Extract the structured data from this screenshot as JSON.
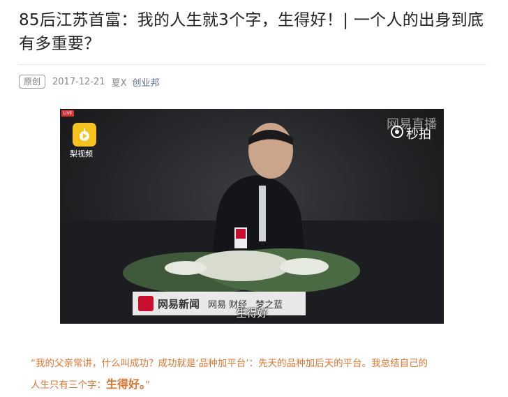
{
  "article": {
    "title": "85后江苏首富：我的人生就3个字，生得好！| 一个人的出身到底有多重要？",
    "badge": "原创",
    "date": "2017-12-21",
    "author": "夏X",
    "account": "创业邦"
  },
  "video": {
    "live_tag": "LIVE",
    "pear_name": "梨视频",
    "watermark_netease": "网易直播",
    "watermark_miaopai": "秒拍",
    "podium_brand": "网易新闻",
    "podium_brand2": "网易 财经",
    "podium_brand3": "梦之蓝",
    "subtitle": "生得好"
  },
  "quote": {
    "line1": "“我的父亲常讲，什么叫成功？成功就是‘品种加平台’：先天的品种加后天的平台。我总结自己的",
    "line2_prefix": "人生只有三个字：",
    "line2_strong": "生得好。",
    "line2_suffix": "”"
  },
  "colors": {
    "link": "#576b95",
    "quote": "#e0752f"
  }
}
